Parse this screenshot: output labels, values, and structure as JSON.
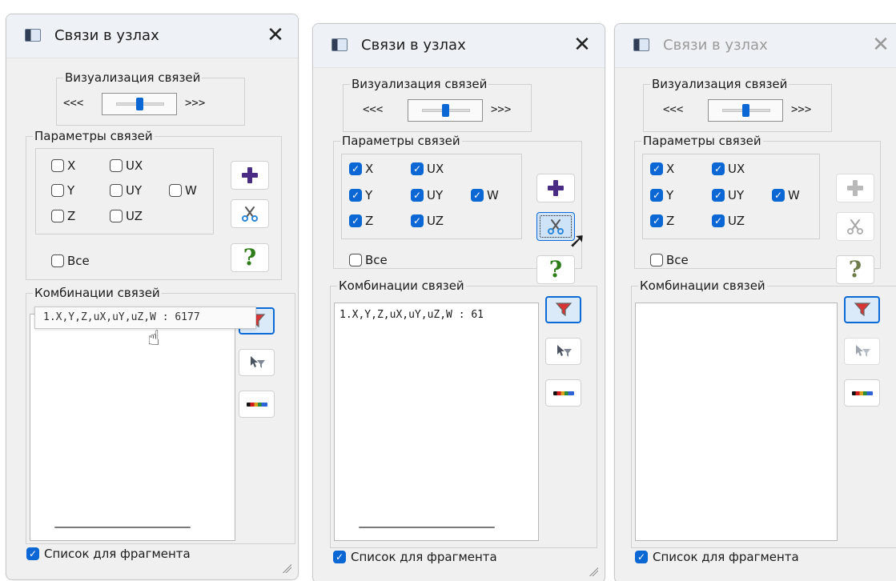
{
  "dialogs": [
    {
      "title": "Связи в узлах",
      "close_label": "✕",
      "visualization": {
        "legend": "Визуализация связей",
        "left_label": "<<<",
        "right_label": ">>>"
      },
      "parameters": {
        "legend": "Параметры связей",
        "checkbox_x": "X",
        "checkbox_ux": "UX",
        "checkbox_y": "Y",
        "checkbox_uy": "UY",
        "checkbox_w": "W",
        "checkbox_z": "Z",
        "checkbox_uz": "UZ",
        "all_label": "Все"
      },
      "combinations": {
        "legend": "Комбинации связей",
        "tooltip": "1.X,Y,Z,uX,uY,uZ,W  :  6177"
      },
      "footer": {
        "label": "Список для фрагмента"
      },
      "icons": {
        "title": "window-icon",
        "add": "plus-icon",
        "cut": "scissors-icon",
        "help": "question-icon",
        "filter": "funnel-icon",
        "select_filter": "cursor-filter-icon",
        "spectrum": "gradient-icon"
      }
    },
    {
      "title": "Связи в узлах",
      "close_label": "✕",
      "visualization": {
        "legend": "Визуализация связей",
        "left_label": "<<<",
        "right_label": ">>>"
      },
      "parameters": {
        "legend": "Параметры связей",
        "checkbox_x": "X",
        "checkbox_ux": "UX",
        "checkbox_y": "Y",
        "checkbox_uy": "UY",
        "checkbox_w": "W",
        "checkbox_z": "Z",
        "checkbox_uz": "UZ",
        "all_label": "Все"
      },
      "combinations": {
        "legend": "Комбинации связей",
        "item": "1.X,Y,Z,uX,uY,uZ,W  :  61"
      },
      "footer": {
        "label": "Список для фрагмента"
      },
      "icons": {
        "title": "window-icon",
        "add": "plus-icon",
        "cut": "scissors-icon",
        "help": "question-icon",
        "filter": "funnel-icon",
        "select_filter": "cursor-filter-icon",
        "spectrum": "gradient-icon"
      }
    },
    {
      "title": "Связи в узлах",
      "close_label": "✕",
      "visualization": {
        "legend": "Визуализация связей",
        "left_label": "<<<",
        "right_label": ">>>"
      },
      "parameters": {
        "legend": "Параметры связей",
        "checkbox_x": "X",
        "checkbox_ux": "UX",
        "checkbox_y": "Y",
        "checkbox_uy": "UY",
        "checkbox_w": "W",
        "checkbox_z": "Z",
        "checkbox_uz": "UZ",
        "all_label": "Все"
      },
      "combinations": {
        "legend": "Комбинации связей"
      },
      "footer": {
        "label": "Список для фрагмента"
      },
      "icons": {
        "title": "window-icon",
        "add": "plus-icon",
        "cut": "scissors-icon",
        "help": "question-icon",
        "filter": "funnel-icon",
        "select_filter": "cursor-filter-icon",
        "spectrum": "gradient-icon"
      }
    }
  ],
  "colors": {
    "accent": "#0b67d4",
    "window_bg": "#f0f0f0",
    "title_bg": "#eef1f6",
    "plus_purple": "#4b2c84",
    "help_green": "#2f7d1a"
  }
}
